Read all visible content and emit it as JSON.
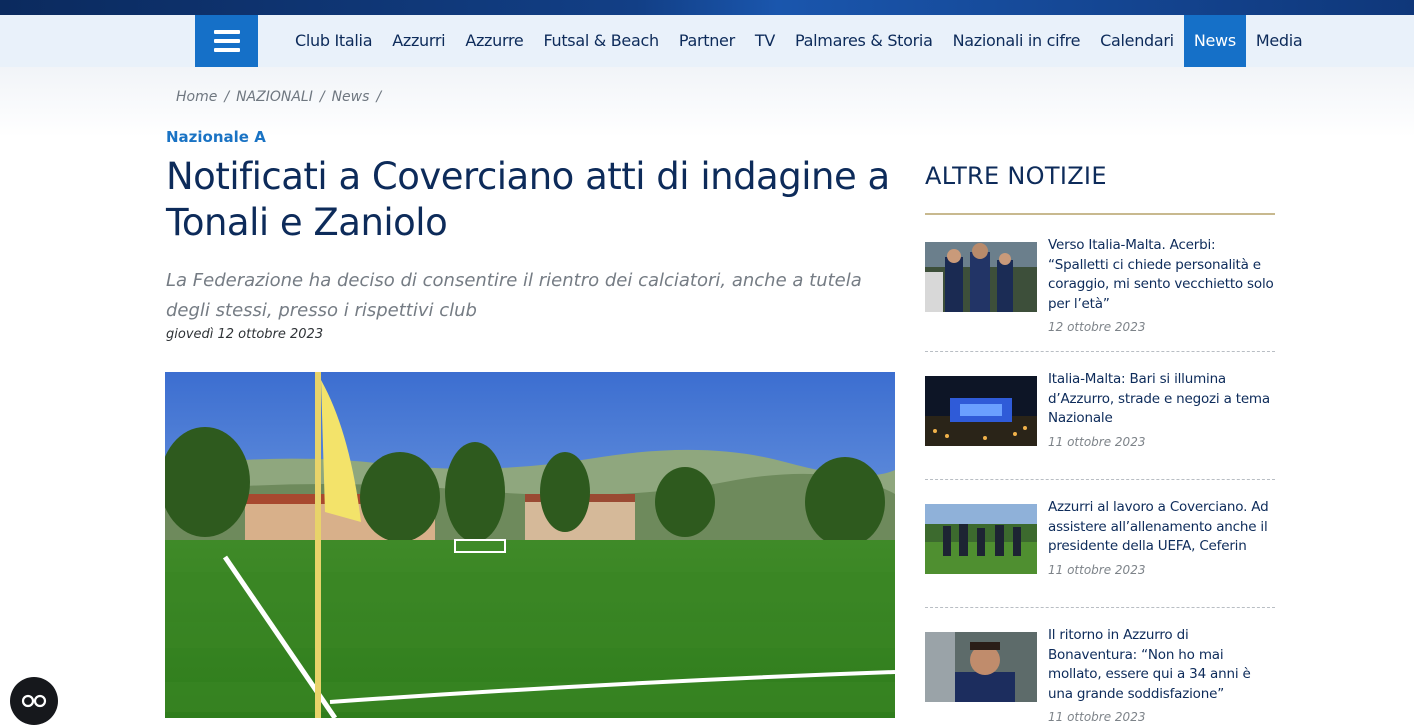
{
  "nav": {
    "menu_icon": "hamburger-menu-icon",
    "items": [
      {
        "label": "Club Italia",
        "active": false
      },
      {
        "label": "Azzurri",
        "active": false
      },
      {
        "label": "Azzurre",
        "active": false
      },
      {
        "label": "Futsal & Beach",
        "active": false
      },
      {
        "label": "Partner",
        "active": false
      },
      {
        "label": "TV",
        "active": false
      },
      {
        "label": "Palmares & Storia",
        "active": false
      },
      {
        "label": "Nazionali in cifre",
        "active": false
      },
      {
        "label": "Calendari",
        "active": false
      },
      {
        "label": "News",
        "active": true
      },
      {
        "label": "Media",
        "active": false
      }
    ],
    "active_color": "#1570c8"
  },
  "breadcrumb": {
    "items": [
      "Home",
      "NAZIONALI",
      "News"
    ],
    "separator": "/"
  },
  "article": {
    "kicker": "Nazionale A",
    "title": "Notificati a Coverciano atti di indagine a Tonali e Zaniolo",
    "subtitle": "La Federazione ha deciso di consentire il rientro dei calciatori, anche a tutela degli stessi, presso i rispettivi club",
    "date": "giovedì 12 ottobre 2023",
    "image": "coverciano-football-pitch-with-corner-flag"
  },
  "sidebar": {
    "title": "ALTRE NOTIZIE",
    "news": [
      {
        "title": "Verso Italia-Malta. Acerbi: “Spalletti ci chiede personalità e coraggio, mi sento vecchietto solo per l’età”",
        "date": "12 ottobre 2023",
        "thumb": "players-training-thumb"
      },
      {
        "title": "Italia-Malta: Bari si illumina d’Azzurro, strade e negozi a tema Nazionale",
        "date": "11 ottobre 2023",
        "thumb": "bari-night-lights-thumb"
      },
      {
        "title": "Azzurri al lavoro a Coverciano. Ad assistere all’allenamento anche il presidente della UEFA, Ceferin",
        "date": "11 ottobre 2023",
        "thumb": "coverciano-officials-thumb"
      },
      {
        "title": "Il ritorno in Azzurro di Bonaventura: “Non ho mai mollato, essere qui a 34 anni è una grande soddisfazione”",
        "date": "11 ottobre 2023",
        "thumb": "bonaventura-portrait-thumb"
      }
    ]
  },
  "accessibility": {
    "icon": "accessibility-glasses-icon"
  },
  "colors": {
    "navy": "#0d2b5a",
    "brand_blue": "#1570c8",
    "gold_rule": "#c8b98f"
  }
}
